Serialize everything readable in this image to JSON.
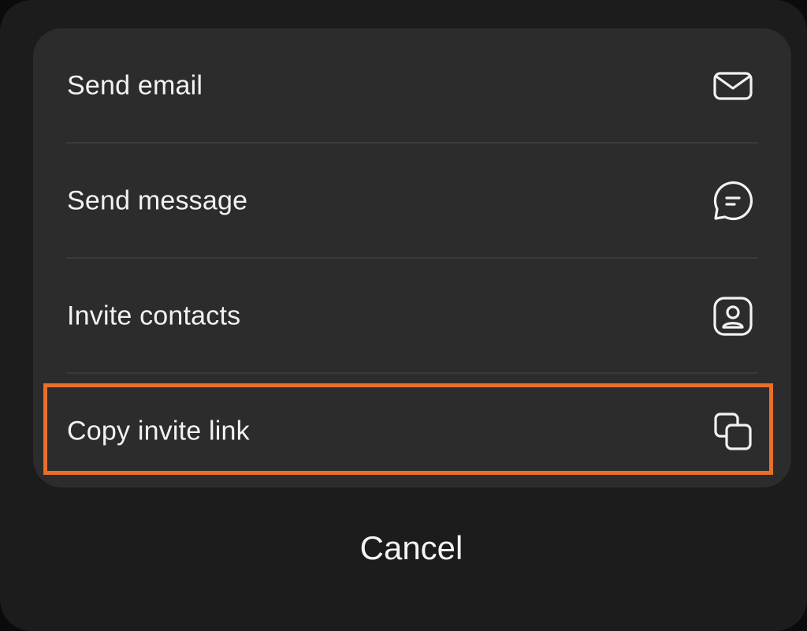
{
  "options": [
    {
      "label": "Send email",
      "icon": "envelope-icon"
    },
    {
      "label": "Send message",
      "icon": "chat-bubble-icon"
    },
    {
      "label": "Invite contacts",
      "icon": "contact-card-icon"
    },
    {
      "label": "Copy invite link",
      "icon": "copy-icon"
    }
  ],
  "cancel_label": "Cancel",
  "colors": {
    "sheet_background": "#1c1c1c",
    "card_background": "#2c2c2c",
    "text": "#f2f2f2",
    "highlight": "#e8702a"
  }
}
